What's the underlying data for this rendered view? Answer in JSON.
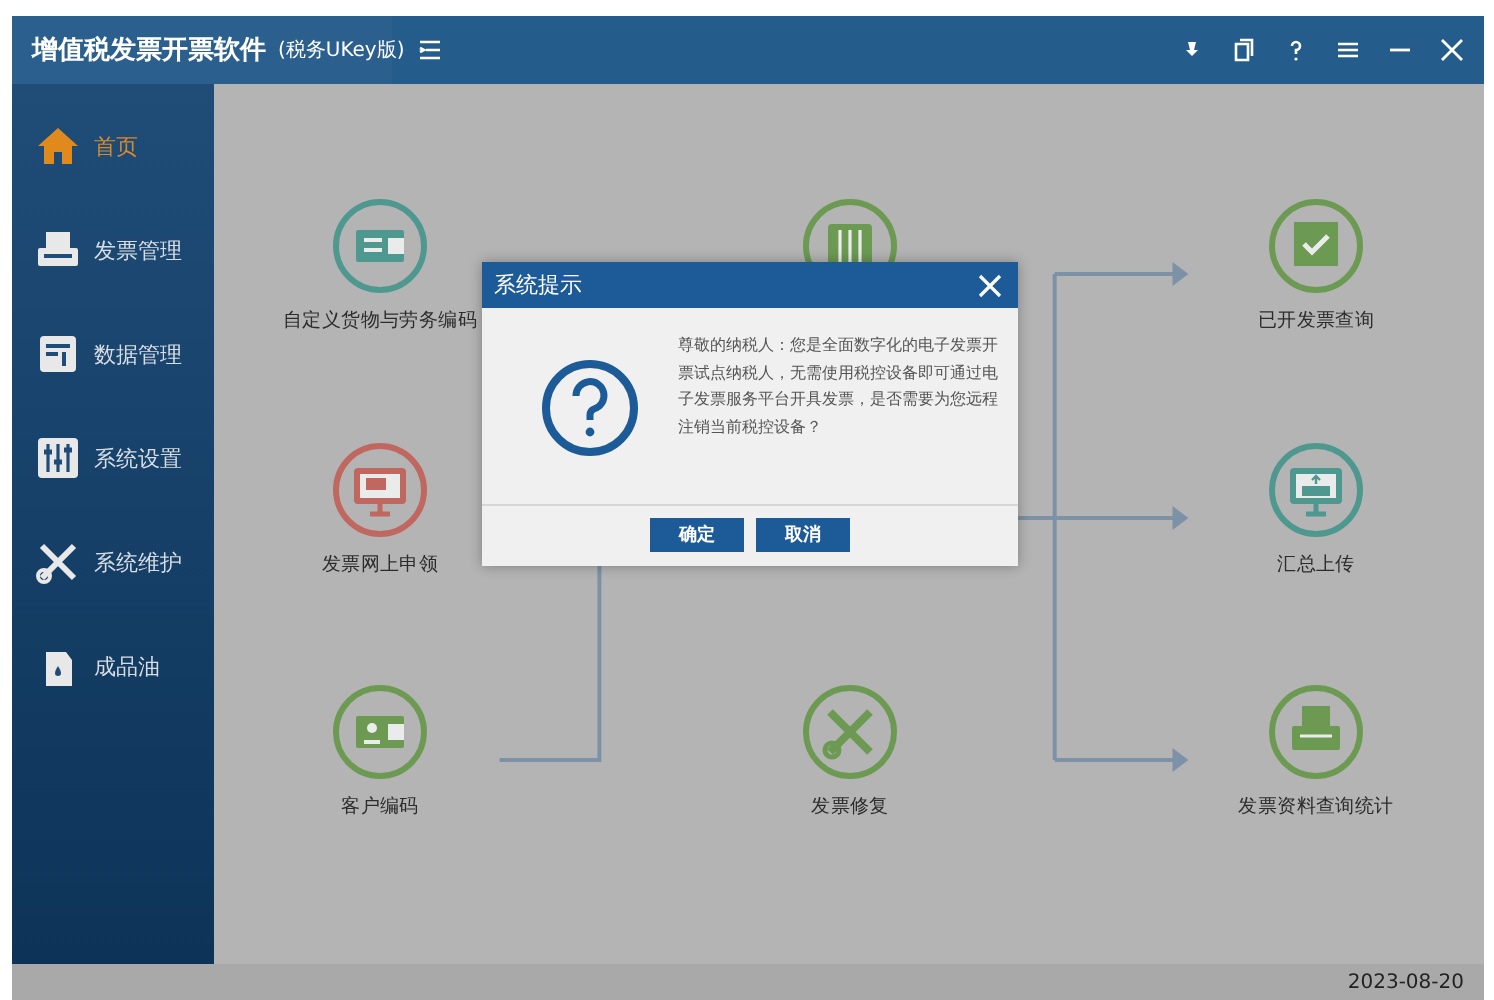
{
  "window": {
    "title": "增值税发票开票软件",
    "subtitle": "(税务UKey版)"
  },
  "sidebar": {
    "items": [
      {
        "label": "首页",
        "kind": "home",
        "selected": true
      },
      {
        "label": "发票管理",
        "kind": "printer",
        "selected": false
      },
      {
        "label": "数据管理",
        "kind": "data",
        "selected": false
      },
      {
        "label": "系统设置",
        "kind": "sliders",
        "selected": false
      },
      {
        "label": "系统维护",
        "kind": "tools",
        "selected": false
      },
      {
        "label": "成品油",
        "kind": "oil",
        "selected": false
      }
    ]
  },
  "nodes": [
    {
      "label": "自定义货物与劳务编码",
      "kind": "card",
      "color": "#4f9890"
    },
    {
      "kind": "sliders",
      "color": "#6c9a52"
    },
    {
      "label": "已开发票查询",
      "kind": "check",
      "color": "#6c9a52"
    },
    {
      "label": "发票网上申领",
      "kind": "monitor",
      "color": "#c0675f"
    },
    {
      "label": "汇总上传",
      "kind": "upload",
      "color": "#4f9890"
    },
    {
      "label": "客户编码",
      "kind": "wallet",
      "color": "#6c9a52"
    },
    {
      "label": "发票修复",
      "kind": "tools",
      "color": "#6c9a52"
    },
    {
      "label": "发票资料查询统计",
      "kind": "print",
      "color": "#6c9a52"
    }
  ],
  "dialog": {
    "title": "系统提示",
    "message": "尊敬的纳税人：您是全面数字化的电子发票开票试点纳税人，无需使用税控设备即可通过电子发票服务平台开具发票，是否需要为您远程注销当前税控设备？",
    "buttons": [
      "确定",
      "取消"
    ]
  },
  "status_bar": {
    "date": "2023-08-20"
  }
}
